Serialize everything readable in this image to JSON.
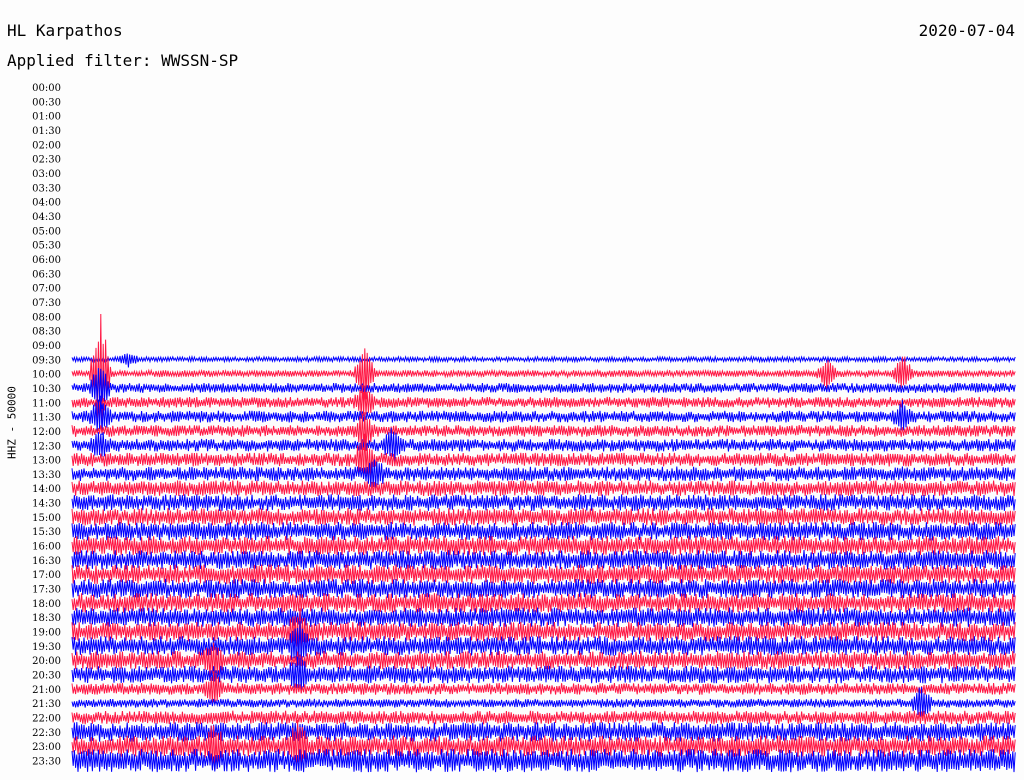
{
  "header": {
    "station": "HL Karpathos",
    "date": "2020-07-04",
    "filter_label": "Applied filter: WWSSN-SP"
  },
  "chart_data": {
    "type": "line",
    "title": "HL Karpathos",
    "subtitle": "Applied filter: WWSSN-SP",
    "ylabel": "HHZ - 50000",
    "xlabel": "",
    "tick_labels": [
      "00:00",
      "00:30",
      "01:00",
      "01:30",
      "02:00",
      "02:30",
      "03:00",
      "03:30",
      "04:00",
      "04:30",
      "05:00",
      "05:30",
      "06:00",
      "06:30",
      "07:00",
      "07:30",
      "08:00",
      "08:30",
      "09:00",
      "09:30",
      "10:00",
      "10:30",
      "11:00",
      "11:30",
      "12:00",
      "12:30",
      "13:00",
      "13:30",
      "14:00",
      "14:30",
      "15:00",
      "15:30",
      "16:00",
      "16:30",
      "17:00",
      "17:30",
      "18:00",
      "18:30",
      "19:00",
      "19:30",
      "20:00",
      "20:30",
      "21:00",
      "21:30",
      "22:00",
      "22:30",
      "23:00",
      "23:30"
    ],
    "colors": [
      "#0000ff",
      "#ff1744"
    ],
    "legend": "none",
    "grid": false,
    "first_trace_row": "09:30",
    "traces": [
      {
        "row": "09:30",
        "start_fraction": 0.0,
        "end_fraction": 1.0,
        "amplitude": 0.25,
        "events": [
          {
            "at": 0.06,
            "amp": 0.9
          }
        ]
      },
      {
        "row": "10:00",
        "start_fraction": 0.0,
        "end_fraction": 1.0,
        "amplitude": 0.35,
        "events": [
          {
            "at": 0.03,
            "amp": 8.0
          },
          {
            "at": 0.31,
            "amp": 4.0
          },
          {
            "at": 0.8,
            "amp": 2.0
          },
          {
            "at": 0.88,
            "amp": 2.5
          }
        ]
      },
      {
        "row": "10:30",
        "start_fraction": 0.0,
        "end_fraction": 1.0,
        "amplitude": 0.5,
        "events": [
          {
            "at": 0.03,
            "amp": 3.0
          }
        ]
      },
      {
        "row": "11:00",
        "start_fraction": 0.0,
        "end_fraction": 1.0,
        "amplitude": 0.55,
        "events": [
          {
            "at": 0.31,
            "amp": 2.0
          }
        ]
      },
      {
        "row": "11:30",
        "start_fraction": 0.0,
        "end_fraction": 1.0,
        "amplitude": 0.6,
        "events": [
          {
            "at": 0.03,
            "amp": 2.5
          },
          {
            "at": 0.88,
            "amp": 1.5
          }
        ]
      },
      {
        "row": "12:00",
        "start_fraction": 0.0,
        "end_fraction": 1.0,
        "amplitude": 0.6,
        "events": [
          {
            "at": 0.31,
            "amp": 2.5
          }
        ]
      },
      {
        "row": "12:30",
        "start_fraction": 0.0,
        "end_fraction": 1.0,
        "amplitude": 0.65,
        "events": [
          {
            "at": 0.03,
            "amp": 1.5
          },
          {
            "at": 0.34,
            "amp": 2.0
          }
        ]
      },
      {
        "row": "13:00",
        "start_fraction": 0.0,
        "end_fraction": 1.0,
        "amplitude": 0.7,
        "events": [
          {
            "at": 0.31,
            "amp": 3.0
          }
        ]
      },
      {
        "row": "13:30",
        "start_fraction": 0.0,
        "end_fraction": 1.0,
        "amplitude": 0.75,
        "events": [
          {
            "at": 0.32,
            "amp": 2.0
          }
        ]
      },
      {
        "row": "14:00",
        "start_fraction": 0.0,
        "end_fraction": 1.0,
        "amplitude": 0.8,
        "events": []
      },
      {
        "row": "14:30",
        "start_fraction": 0.0,
        "end_fraction": 1.0,
        "amplitude": 0.85,
        "events": []
      },
      {
        "row": "15:00",
        "start_fraction": 0.0,
        "end_fraction": 1.0,
        "amplitude": 0.9,
        "events": []
      },
      {
        "row": "15:30",
        "start_fraction": 0.0,
        "end_fraction": 1.0,
        "amplitude": 0.95,
        "events": []
      },
      {
        "row": "16:00",
        "start_fraction": 0.0,
        "end_fraction": 1.0,
        "amplitude": 1.0,
        "events": []
      },
      {
        "row": "16:30",
        "start_fraction": 0.0,
        "end_fraction": 1.0,
        "amplitude": 1.0,
        "events": []
      },
      {
        "row": "17:00",
        "start_fraction": 0.0,
        "end_fraction": 1.0,
        "amplitude": 1.0,
        "events": []
      },
      {
        "row": "17:30",
        "start_fraction": 0.0,
        "end_fraction": 1.0,
        "amplitude": 1.0,
        "events": []
      },
      {
        "row": "18:00",
        "start_fraction": 0.0,
        "end_fraction": 1.0,
        "amplitude": 1.0,
        "events": []
      },
      {
        "row": "18:30",
        "start_fraction": 0.0,
        "end_fraction": 1.0,
        "amplitude": 1.0,
        "events": []
      },
      {
        "row": "19:00",
        "start_fraction": 0.0,
        "end_fraction": 1.0,
        "amplitude": 1.0,
        "events": [
          {
            "at": 0.24,
            "amp": 2.0
          }
        ]
      },
      {
        "row": "19:30",
        "start_fraction": 0.0,
        "end_fraction": 1.0,
        "amplitude": 1.0,
        "events": [
          {
            "at": 0.24,
            "amp": 2.5
          }
        ]
      },
      {
        "row": "20:00",
        "start_fraction": 0.0,
        "end_fraction": 1.0,
        "amplitude": 0.95,
        "events": [
          {
            "at": 0.15,
            "amp": 2.0
          }
        ]
      },
      {
        "row": "20:30",
        "start_fraction": 0.0,
        "end_fraction": 1.0,
        "amplitude": 0.9,
        "events": [
          {
            "at": 0.24,
            "amp": 2.0
          }
        ]
      },
      {
        "row": "21:00",
        "start_fraction": 0.0,
        "end_fraction": 1.0,
        "amplitude": 0.6,
        "events": [
          {
            "at": 0.15,
            "amp": 2.0
          }
        ]
      },
      {
        "row": "21:30",
        "start_fraction": 0.0,
        "end_fraction": 1.0,
        "amplitude": 0.45,
        "events": [
          {
            "at": 0.9,
            "amp": 2.0
          }
        ]
      },
      {
        "row": "22:00",
        "start_fraction": 0.0,
        "end_fraction": 1.0,
        "amplitude": 0.7,
        "events": []
      },
      {
        "row": "22:30",
        "start_fraction": 0.0,
        "end_fraction": 1.0,
        "amplitude": 1.0,
        "events": []
      },
      {
        "row": "23:00",
        "start_fraction": 0.0,
        "end_fraction": 1.0,
        "amplitude": 1.1,
        "events": [
          {
            "at": 0.15,
            "amp": 2.5
          },
          {
            "at": 0.24,
            "amp": 2.5
          }
        ]
      },
      {
        "row": "23:30",
        "start_fraction": 0.0,
        "end_fraction": 1.0,
        "amplitude": 1.2,
        "events": []
      }
    ]
  }
}
